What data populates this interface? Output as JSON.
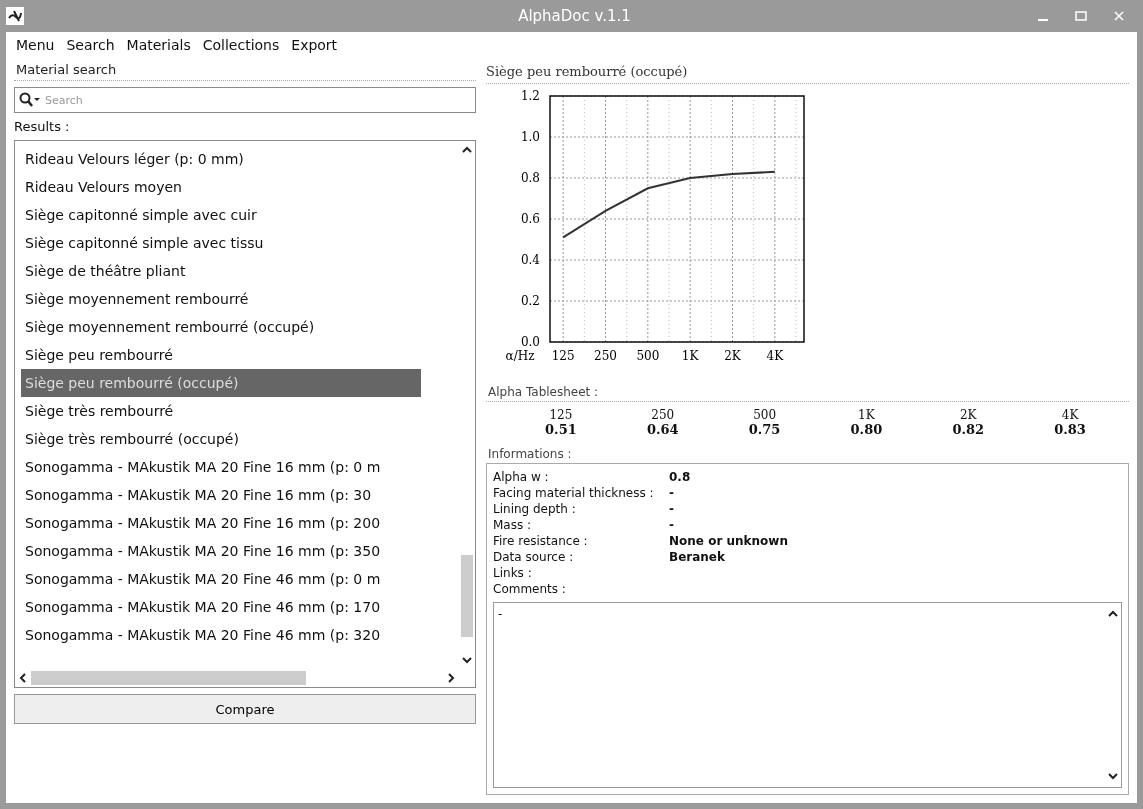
{
  "window": {
    "title": "AlphaDoc v.1.1"
  },
  "menu": [
    "Menu",
    "Search",
    "Materials",
    "Collections",
    "Export"
  ],
  "search_panel": {
    "title": "Material search",
    "search": {
      "placeholder": "Search"
    },
    "results_label": "Results :",
    "results": [
      {
        "label": "Rideau Velours léger (p: 0 mm)",
        "selected": false
      },
      {
        "label": "Rideau Velours moyen",
        "selected": false
      },
      {
        "label": "Siège capitonné simple avec cuir",
        "selected": false
      },
      {
        "label": "Siège capitonné simple avec tissu",
        "selected": false
      },
      {
        "label": "Siège de théâtre pliant",
        "selected": false
      },
      {
        "label": "Siège moyennement rembourré",
        "selected": false
      },
      {
        "label": "Siège moyennement rembourré (occupé)",
        "selected": false
      },
      {
        "label": "Siège peu rembourré",
        "selected": false
      },
      {
        "label": "Siège peu rembourré (occupé)",
        "selected": true
      },
      {
        "label": "Siège très rembourré",
        "selected": false
      },
      {
        "label": "Siège très rembourré (occupé)",
        "selected": false
      },
      {
        "label": "Sonogamma - MAkustik MA 20 Fine 16 mm (p: 0 m",
        "selected": false
      },
      {
        "label": "Sonogamma - MAkustik MA 20 Fine 16 mm (p: 30",
        "selected": false
      },
      {
        "label": "Sonogamma - MAkustik MA 20 Fine 16 mm (p: 200",
        "selected": false
      },
      {
        "label": "Sonogamma - MAkustik MA 20 Fine 16 mm (p: 350",
        "selected": false
      },
      {
        "label": "Sonogamma - MAkustik MA 20 Fine 46 mm (p: 0 m",
        "selected": false
      },
      {
        "label": "Sonogamma - MAkustik MA 20 Fine 46 mm (p: 170",
        "selected": false
      },
      {
        "label": "Sonogamma - MAkustik MA 20 Fine 46 mm (p: 320",
        "selected": false
      }
    ],
    "compare_button": "Compare"
  },
  "detail": {
    "title": "Siège peu rembourré (occupé)",
    "chart_data": {
      "type": "line",
      "xlabel": "α/Hz",
      "categories": [
        "125",
        "250",
        "500",
        "1K",
        "2K",
        "4K"
      ],
      "grid": true,
      "series": [
        {
          "color": "#333333",
          "values": [
            0.51,
            0.64,
            0.75,
            0.8,
            0.82,
            0.83
          ]
        }
      ],
      "ylim": [
        0,
        1.2
      ],
      "yticks": [
        {
          "value": 0,
          "label": "0.0"
        },
        {
          "value": 0.2,
          "label": "0.2"
        },
        {
          "value": 0.4,
          "label": "0.4"
        },
        {
          "value": 0.6,
          "label": "0.6"
        },
        {
          "value": 0.8,
          "label": "0.8"
        },
        {
          "value": 1,
          "label": "1.0"
        },
        {
          "value": 1.2,
          "label": "1.2"
        }
      ]
    },
    "tablesheet_label": "Alpha Tablesheet :",
    "tablesheet": [
      {
        "band": "125",
        "value": "0.51"
      },
      {
        "band": "250",
        "value": "0.64"
      },
      {
        "band": "500",
        "value": "0.75"
      },
      {
        "band": "1K",
        "value": "0.80"
      },
      {
        "band": "2K",
        "value": "0.82"
      },
      {
        "band": "4K",
        "value": "0.83"
      }
    ],
    "informations_label": "Informations :",
    "informations": [
      {
        "label": "Alpha w :",
        "value": "0.8"
      },
      {
        "label": "Facing material thickness :",
        "value": "-"
      },
      {
        "label": "Lining depth :",
        "value": "-"
      },
      {
        "label": "Mass :",
        "value": "-"
      },
      {
        "label": "Fire resistance :",
        "value": "None or unknown"
      },
      {
        "label": "Data source :",
        "value": "Beranek"
      },
      {
        "label": "Links :"
      },
      {
        "label": "Comments :"
      }
    ],
    "comments": "-"
  }
}
